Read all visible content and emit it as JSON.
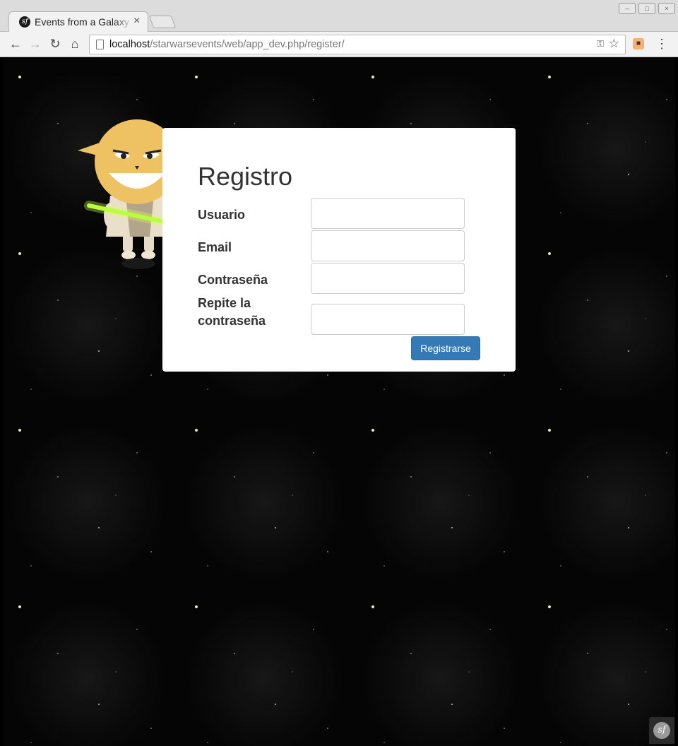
{
  "browser": {
    "tab_title": "Events from a Galaxy",
    "tab_close": "×",
    "url_host": "localhost",
    "url_path": "/starwarsevents/web/app_dev.php/register/"
  },
  "icons": {
    "back": "back-arrow-icon",
    "forward": "forward-arrow-icon",
    "reload": "reload-icon",
    "home": "home-icon",
    "page": "page-icon",
    "key": "key-icon",
    "star": "bookmark-star-icon",
    "extension": "extension-icon",
    "menu": "menu-icon",
    "symfony": "symfony-logo-icon"
  },
  "form": {
    "title": "Registro",
    "fields": [
      {
        "label": "Usuario",
        "value": ""
      },
      {
        "label": "Email",
        "value": ""
      },
      {
        "label": "Contraseña",
        "value": ""
      },
      {
        "label": "Repite la contraseña",
        "value": ""
      }
    ],
    "submit_label": "Registrarse"
  },
  "colors": {
    "background": "#050505",
    "panel": "#ffffff",
    "button": "#337ab7",
    "mascot_skin": "#eec262",
    "lightsaber": "#b9ff3a"
  }
}
